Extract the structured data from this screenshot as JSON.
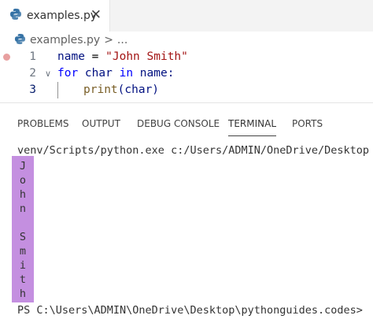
{
  "tab": {
    "filename": "examples.py",
    "close": "✕"
  },
  "breadcrumb": {
    "file": "examples.py",
    "separator": ">",
    "more": "..."
  },
  "editor": {
    "lines": [
      {
        "num": "1",
        "parts": [
          "name",
          " = ",
          "\"John Smith\""
        ]
      },
      {
        "num": "2",
        "parts": [
          "for",
          " char ",
          "in",
          " name:"
        ]
      },
      {
        "num": "3",
        "parts": [
          "print",
          "(char)"
        ]
      }
    ]
  },
  "panel": {
    "tabs": [
      "PROBLEMS",
      "OUTPUT",
      "DEBUG CONSOLE",
      "TERMINAL",
      "PORTS"
    ],
    "active_tab": "TERMINAL"
  },
  "terminal": {
    "command_line": "venv/Scripts/python.exe c:/Users/ADMIN/OneDrive/Desktop",
    "output_chars": [
      "J",
      "o",
      "h",
      "n",
      "",
      "S",
      "m",
      "i",
      "t",
      "h"
    ],
    "prompt": "PS C:\\Users\\ADMIN\\OneDrive\\Desktop\\pythonguides.codes>"
  },
  "colors": {
    "highlight": "#c48fe0",
    "keyword": "#0000ff",
    "string": "#a31515",
    "python_icon": "#3572a5"
  }
}
